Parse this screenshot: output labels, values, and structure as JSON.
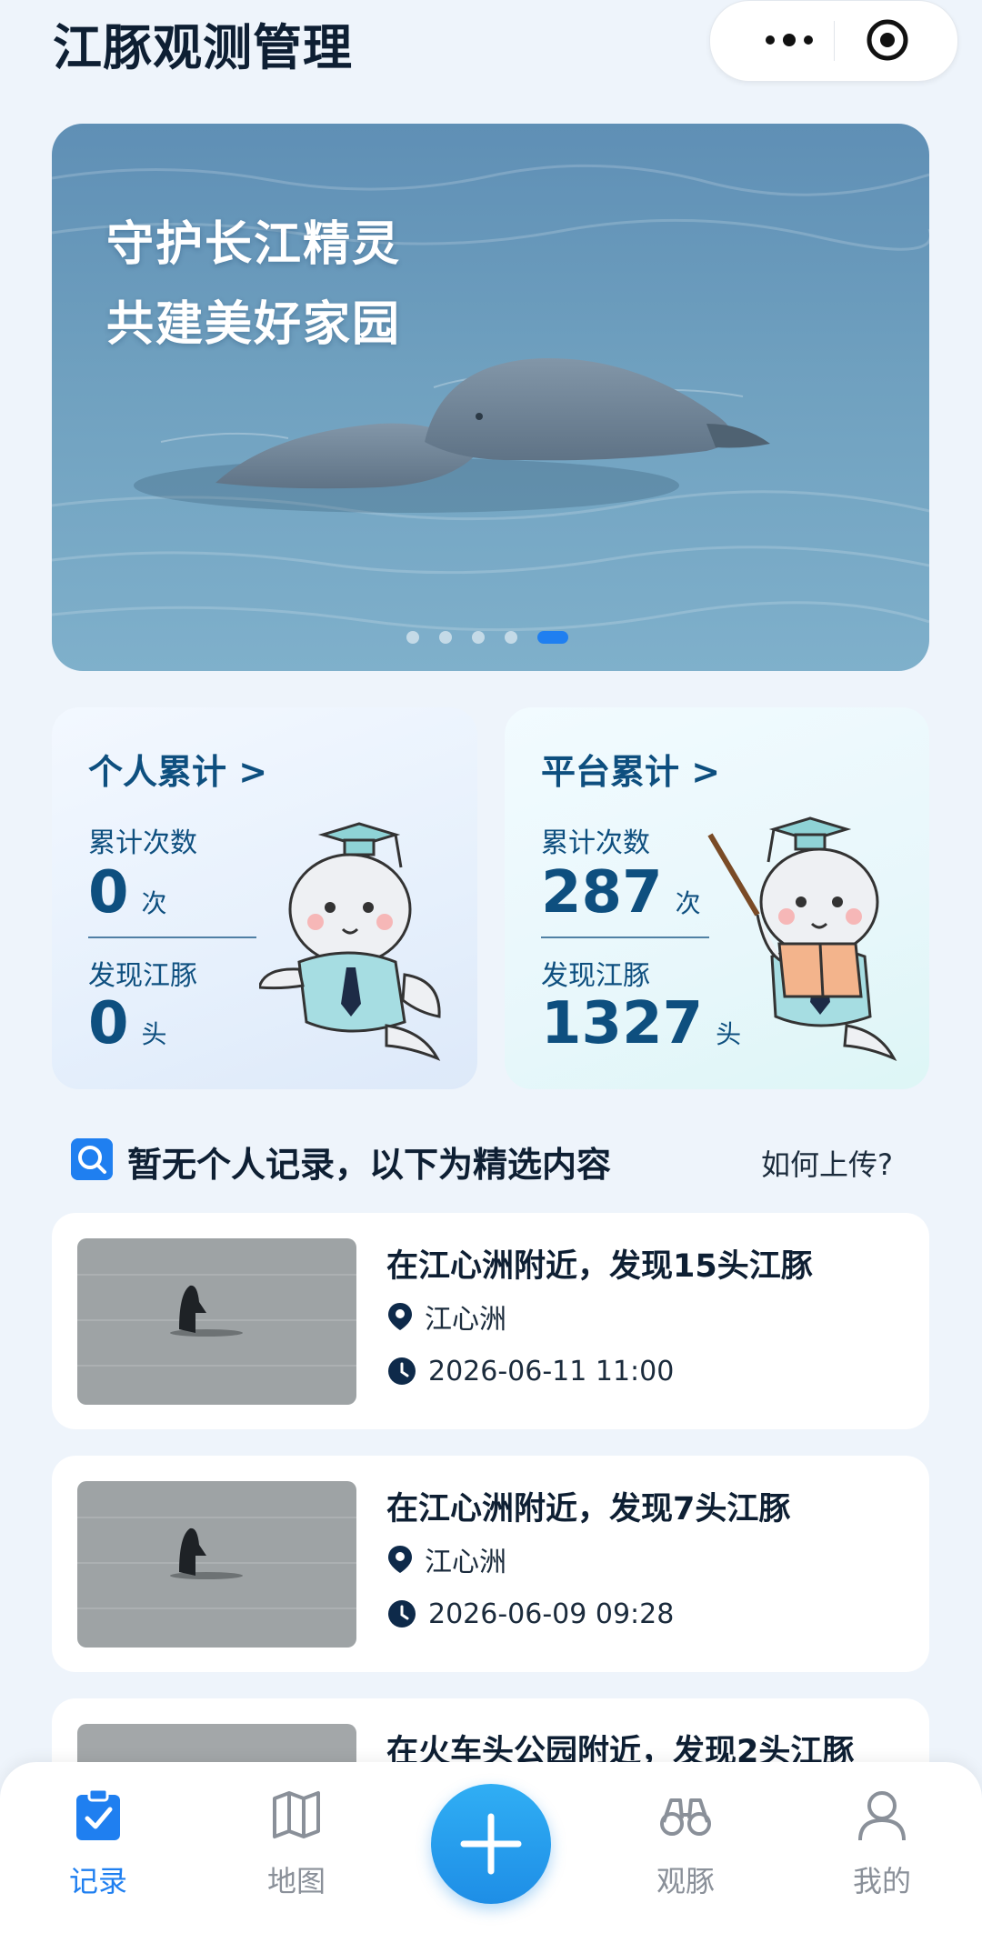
{
  "header": {
    "title": "江豚观测管理",
    "menu_icon": "more-dots-icon",
    "close_icon": "target-icon"
  },
  "banner": {
    "line1": "守护长江精灵",
    "line2": "共建美好家园",
    "slide_count": 5,
    "active_slide": 5
  },
  "stats": {
    "personal": {
      "title": "个人累计 >",
      "count_label": "累计次数",
      "count_value": "0",
      "count_unit": "次",
      "found_label": "发现江豚",
      "found_value": "0",
      "found_unit": "头"
    },
    "platform": {
      "title": "平台累计 >",
      "count_label": "累计次数",
      "count_value": "287",
      "count_unit": "次",
      "found_label": "发现江豚",
      "found_value": "1327",
      "found_unit": "头"
    }
  },
  "section": {
    "title": "暂无个人记录，以下为精选内容",
    "howto": "如何上传?"
  },
  "records": [
    {
      "title": "在江心洲附近，发现15头江豚",
      "location": "江心洲",
      "time": "2026-06-11 11:00"
    },
    {
      "title": "在江心洲附近，发现7头江豚",
      "location": "江心洲",
      "time": "2026-06-09 09:28"
    },
    {
      "title": "在火车头公园附近，发现2头江豚",
      "location": "",
      "time": ""
    }
  ],
  "nav": {
    "items": [
      {
        "label": "记录",
        "icon": "clipboard-check-icon",
        "active": true
      },
      {
        "label": "地图",
        "icon": "map-icon",
        "active": false
      },
      {
        "label": "观豚",
        "icon": "binoculars-icon",
        "active": false
      },
      {
        "label": "我的",
        "icon": "user-icon",
        "active": false
      }
    ],
    "fab_icon": "plus-icon"
  },
  "colors": {
    "accent": "#1f7ff0",
    "title_blue": "#0e4f7f",
    "background": "#eef4fb"
  }
}
